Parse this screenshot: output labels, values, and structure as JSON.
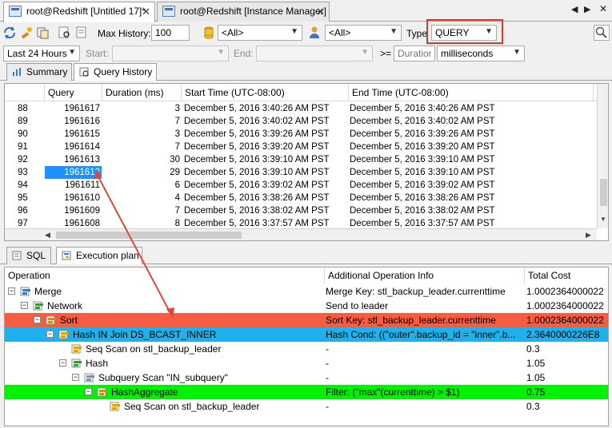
{
  "tabs": [
    {
      "label": "root@Redshift [Untitled 17]*"
    },
    {
      "label": "root@Redshift [Instance Manager]"
    }
  ],
  "nav": {
    "prev": "◀",
    "next": "▶",
    "close": "✕"
  },
  "toolbar": {
    "max_history_label": "Max History:",
    "max_history_value": "100",
    "filter1_value": "<All>",
    "filter2_value": "<All>",
    "type_label": "Type",
    "type_value": "QUERY",
    "range_value": "Last 24 Hours",
    "start_label": "Start:",
    "end_label": "End:",
    "duration_op": ">=",
    "duration_placeholder": "Duration",
    "duration_unit": "milliseconds"
  },
  "upper_tabs": [
    {
      "label": "Summary"
    },
    {
      "label": "Query History"
    }
  ],
  "history": {
    "columns": [
      "Query",
      "Duration (ms)",
      "Start Time (UTC-08:00)",
      "End Time (UTC-08:00)"
    ],
    "rows": [
      {
        "n": "88",
        "query": "1961617",
        "duration": "3",
        "start": "December 5, 2016 3:40:26 AM PST",
        "end": "December 5, 2016 3:40:26 AM PST"
      },
      {
        "n": "89",
        "query": "1961616",
        "duration": "7",
        "start": "December 5, 2016 3:40:02 AM PST",
        "end": "December 5, 2016 3:40:02 AM PST"
      },
      {
        "n": "90",
        "query": "1961615",
        "duration": "3",
        "start": "December 5, 2016 3:39:26 AM PST",
        "end": "December 5, 2016 3:39:26 AM PST"
      },
      {
        "n": "91",
        "query": "1961614",
        "duration": "7",
        "start": "December 5, 2016 3:39:20 AM PST",
        "end": "December 5, 2016 3:39:20 AM PST"
      },
      {
        "n": "92",
        "query": "1961613",
        "duration": "30",
        "start": "December 5, 2016 3:39:10 AM PST",
        "end": "December 5, 2016 3:39:10 AM PST"
      },
      {
        "n": "93",
        "query": "1961612",
        "duration": "29",
        "start": "December 5, 2016 3:39:10 AM PST",
        "end": "December 5, 2016 3:39:10 AM PST"
      },
      {
        "n": "94",
        "query": "1961611",
        "duration": "6",
        "start": "December 5, 2016 3:39:02 AM PST",
        "end": "December 5, 2016 3:39:02 AM PST"
      },
      {
        "n": "95",
        "query": "1961610",
        "duration": "4",
        "start": "December 5, 2016 3:38:26 AM PST",
        "end": "December 5, 2016 3:38:26 AM PST"
      },
      {
        "n": "96",
        "query": "1961609",
        "duration": "7",
        "start": "December 5, 2016 3:38:02 AM PST",
        "end": "December 5, 2016 3:38:02 AM PST"
      },
      {
        "n": "97",
        "query": "1961608",
        "duration": "8",
        "start": "December 5, 2016 3:37:57 AM PST",
        "end": "December 5, 2016 3:37:57 AM PST"
      }
    ]
  },
  "lower_tabs": [
    {
      "label": "SQL"
    },
    {
      "label": "Execution plan"
    }
  ],
  "plan": {
    "columns": [
      "Operation",
      "Additional Operation Info",
      "Total Cost"
    ],
    "rows": [
      {
        "op": "Merge",
        "info": "Merge Key: stl_backup_leader.currenttime",
        "cost": "1.0002364000022"
      },
      {
        "op": "Network",
        "info": "Send to leader",
        "cost": "1.0002364000022"
      },
      {
        "op": "Sort",
        "info": "Sort Key: stl_backup_leader.currenttime",
        "cost": "1.0002364000022"
      },
      {
        "op": "Hash IN Join DS_BCAST_INNER",
        "info": "Hash Cond: ((\"outer\".backup_id = \"inner\".b...",
        "cost": "2.3640000226E8"
      },
      {
        "op": "Seq Scan on stl_backup_leader",
        "info": "-",
        "cost": "0.3"
      },
      {
        "op": "Hash",
        "info": "-",
        "cost": "1.05"
      },
      {
        "op": "Subquery Scan \"IN_subquery\"",
        "info": "-",
        "cost": "1.05"
      },
      {
        "op": "HashAggregate",
        "info": "Filter: (\"max\"(currenttime) > $1)",
        "cost": "0.75"
      },
      {
        "op": "Seq Scan on stl_backup_leader",
        "info": "-",
        "cost": "0.3"
      }
    ]
  }
}
